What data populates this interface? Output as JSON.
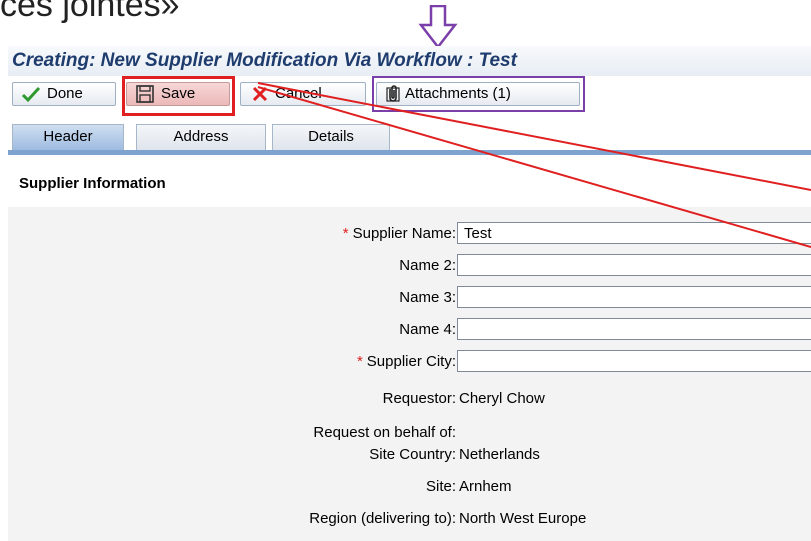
{
  "slide": {
    "heading": "ces jointes»"
  },
  "window": {
    "title": "Creating: New Supplier Modification Via Workflow : Test"
  },
  "toolbar": {
    "done_label": "Done",
    "save_label": "Save",
    "cancel_label": "Cancel",
    "attachments_label": "Attachments (1)"
  },
  "tabs": [
    {
      "label": "Header",
      "active": true
    },
    {
      "label": "Address",
      "active": false
    },
    {
      "label": "Details",
      "active": false
    }
  ],
  "section": {
    "title": "Supplier Information"
  },
  "form": {
    "required_marker": "*",
    "fields": [
      {
        "label": "Supplier Name:",
        "required": true,
        "value": "Test"
      },
      {
        "label": "Name 2:",
        "required": false,
        "value": ""
      },
      {
        "label": "Name 3:",
        "required": false,
        "value": ""
      },
      {
        "label": "Name 4:",
        "required": false,
        "value": ""
      },
      {
        "label": "Supplier City:",
        "required": true,
        "value": ""
      }
    ],
    "info": [
      {
        "label": "Requestor:",
        "value": "Cheryl Chow"
      },
      {
        "label": "Request on behalf of:",
        "value": ""
      },
      {
        "label": "Site Country:",
        "value": "Netherlands"
      },
      {
        "label": "Site:",
        "value": "Arnhem"
      },
      {
        "label": "Region (delivering to):",
        "value": "North West Europe"
      }
    ]
  },
  "colors": {
    "highlight_save": "#e02020",
    "highlight_attachments": "#7a3fa8",
    "title_text": "#1f3c6e",
    "tab_accent": "#7fa3cf"
  }
}
